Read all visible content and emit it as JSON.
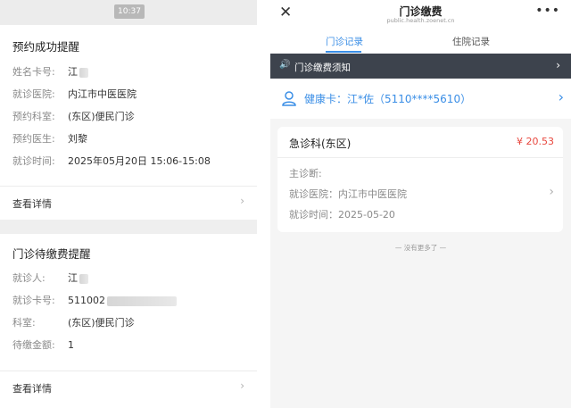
{
  "left": {
    "status_time": "10:37",
    "card1": {
      "title": "预约成功提醒",
      "rows": [
        {
          "label": "姓名卡号:",
          "value": "江"
        },
        {
          "label": "就诊医院:",
          "value": "内江市中医医院"
        },
        {
          "label": "预约科室:",
          "value": "(东区)便民门诊"
        },
        {
          "label": "预约医生:",
          "value": "刘黎"
        },
        {
          "label": "就诊时间:",
          "value": "2025年05月20日 15:06-15:08"
        }
      ],
      "detail": "查看详情"
    },
    "card2": {
      "title": "门诊待缴费提醒",
      "rows": [
        {
          "label": "就诊人:",
          "value": "江"
        },
        {
          "label": "就诊卡号:",
          "value": "511002"
        },
        {
          "label": "科室:",
          "value": "(东区)便民门诊"
        },
        {
          "label": "待缴金额:",
          "value": "1"
        }
      ],
      "detail": "查看详情"
    }
  },
  "right": {
    "title": "门诊缴费",
    "url": "public.health.zoenet.cn",
    "close": "✕",
    "more": "•••",
    "tabs": [
      {
        "label": "门诊记录",
        "active": true
      },
      {
        "label": "住院记录",
        "active": false
      }
    ],
    "notice": "门诊缴费须知",
    "health_card": "健康卡：江*佐（5110****5610）",
    "record": {
      "dept": "急诊科(东区)",
      "price": "¥ 20.53",
      "diagnosis": "主诊断:",
      "hospital": "就诊医院：内江市中医医院",
      "time": "就诊时间：2025-05-20"
    },
    "no_more": "— 没有更多了 —"
  },
  "colors": {
    "accent": "#3a8ee6",
    "price": "#e8483f",
    "notice_bg": "#3d434d"
  }
}
